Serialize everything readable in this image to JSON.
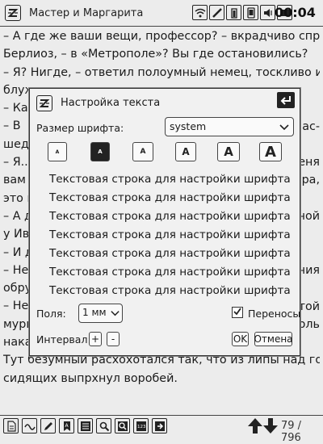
{
  "statusbar": {
    "title": "Мастер и Маргарита",
    "clock": "00:04",
    "icons": [
      "wifi-icon",
      "pen-icon",
      "battery-icon",
      "phone-icon",
      "volume-icon",
      "toggle-icon"
    ]
  },
  "reader": {
    "lines": [
      "– А где же ваши вещи, профессор? – вкрадчиво спрашивал",
      "Берлиоз, – в «Метрополе»? Вы где остановились?",
      "– Я? Нигде, – ответил полоумный немец, тоскливо и дико",
      "блуж",
      "– Как",
      "– В",
      "шед",
      "– Я..",
      "вам",
      "это п",
      "– А д",
      "у Ива",
      "– И д",
      "–   Не",
      "обру",
      "–   Не",
      "мурь",
      "наказание! Перестаньте вы психовать.",
      "Тут безумный расхохотался так, что из липы над головами",
      "сидящих выпрхнул воробей."
    ],
    "right_fragments": [
      {
        "line": 5,
        "text": "мас-"
      },
      {
        "line": 7,
        "text": "меня"
      },
      {
        "line": 8,
        "text": "ера,"
      },
      {
        "line": 10,
        "text": "ьной"
      },
      {
        "line": 13,
        "text": "ния"
      },
      {
        "line": 15,
        "text": "етой"
      },
      {
        "line": 16,
        "text": "боль"
      }
    ]
  },
  "dialog": {
    "title": "Настройка текста",
    "font_size_label": "Размер шрифта:",
    "font_value": "system",
    "font_size_buttons": [
      "A",
      "A",
      "A",
      "A",
      "A",
      "A"
    ],
    "active_font_size_index": 1,
    "sample_lines": [
      "Текстовая строка для настройки шрифта",
      "Текстовая строка для настройки шрифта",
      "Текстовая строка для настройки шрифта",
      "Текстовая строка для настройки шрифта",
      "Текстовая строка для настройки шрифта",
      "Текстовая строка для настройки шрифта",
      "Текстовая строка для настройки шрифта"
    ],
    "margins_label": "Поля:",
    "margins_value": "1 мм",
    "hyphenation_label": "Переносы",
    "hyphenation_checked": true,
    "interval_label": "Интервал:",
    "interval_plus": "+",
    "interval_minus": "-",
    "ok_label": "OK",
    "cancel_label": "Отмена"
  },
  "toolbar": {
    "icons": [
      "document-icon",
      "wave-icon",
      "edit-icon",
      "bookmark-icon",
      "contents-icon",
      "search-icon",
      "zoom-icon",
      "page-goto-icon",
      "exit-icon"
    ],
    "page_indicator": "79 / 796"
  }
}
